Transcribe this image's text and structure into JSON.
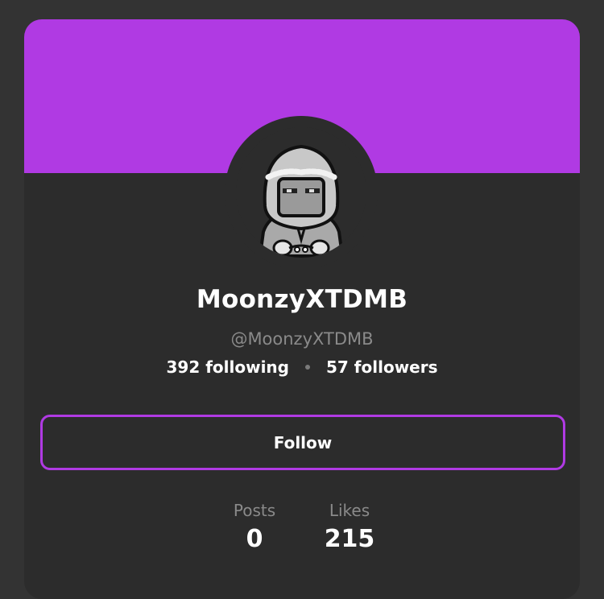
{
  "profile": {
    "display_name": "MoonzyXTDMB",
    "handle": "@MoonzyXTDMB",
    "following": "392 following",
    "followers": "57 followers"
  },
  "actions": {
    "follow_label": "Follow"
  },
  "stats": {
    "posts_label": "Posts",
    "posts_value": "0",
    "likes_label": "Likes",
    "likes_value": "215"
  },
  "colors": {
    "accent": "#b03ae3",
    "background": "#333333",
    "card": "#2c2c2c"
  },
  "icons": {
    "avatar": "hooded-character-avatar"
  }
}
